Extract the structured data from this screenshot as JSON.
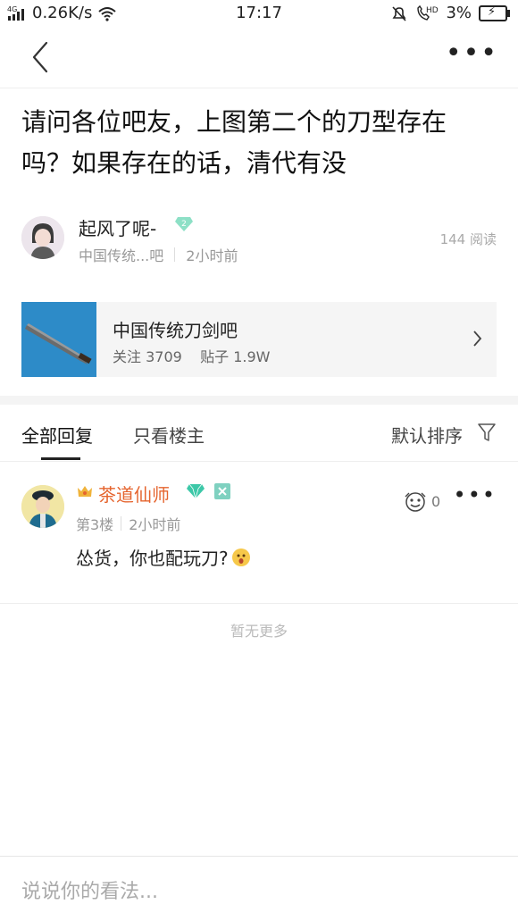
{
  "status_bar": {
    "signal": "4G",
    "speed": "0.26K/s",
    "time": "17:17",
    "hd": "HD",
    "battery": "3%"
  },
  "post": {
    "title": "请问各位吧友，上图第二个的刀型存在吗？如果存在的话，清代有没",
    "author": {
      "name": "起风了呢-",
      "level": "2",
      "forum_short": "中国传统...吧",
      "time": "2小时前"
    },
    "read_count": "144 阅读"
  },
  "forum": {
    "name": "中国传统刀剑吧",
    "stats": "关注 3709    贴子 1.9W"
  },
  "tabs": {
    "all": "全部回复",
    "owner_only": "只看楼主",
    "sort": "默认排序"
  },
  "replies": [
    {
      "name": "茶道仙师",
      "floor": "第3楼",
      "time": "2小时前",
      "likes": "0",
      "text": "怂货，你也配玩刀?"
    }
  ],
  "no_more": "暂无更多",
  "comment_input": {
    "placeholder": "说说你的看法..."
  },
  "colors": {
    "username_highlight": "#e5642e",
    "gem": "#3cc8a8",
    "forum_thumb": "#2d8bc8"
  }
}
